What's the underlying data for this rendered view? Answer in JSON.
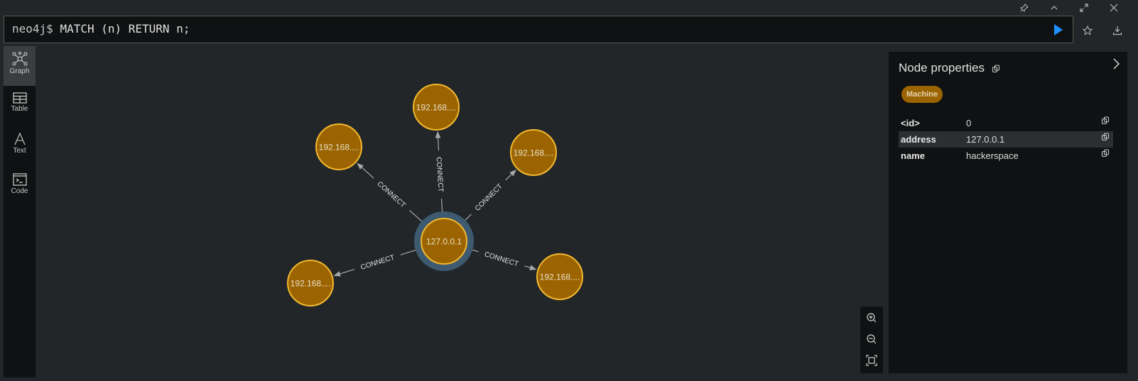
{
  "window": {
    "icons": [
      "pin-icon",
      "chevron-up-icon",
      "maximize-icon",
      "close-icon"
    ]
  },
  "editor": {
    "prompt": "neo4j$",
    "query": "MATCH (n) RETURN n;"
  },
  "actions": {
    "run": "run-icon",
    "favorite": "star-icon",
    "download": "download-icon"
  },
  "nav": {
    "items": [
      {
        "label": "Graph",
        "icon": "graph-icon",
        "active": true
      },
      {
        "label": "Table",
        "icon": "table-icon",
        "active": false
      },
      {
        "label": "Text",
        "icon": "text-icon",
        "active": false
      },
      {
        "label": "Code",
        "icon": "code-icon",
        "active": false
      }
    ]
  },
  "graph": {
    "node_color": "#9b6400",
    "node_border": "#f2b82e",
    "selected_halo": "#3d5a70",
    "relationship_type": "CONNECT",
    "nodes": [
      {
        "id": "center",
        "label": "127.0.0.1",
        "selected": true
      },
      {
        "id": "n-top",
        "label": "192.168...."
      },
      {
        "id": "n-topleft",
        "label": "192.168...."
      },
      {
        "id": "n-topright",
        "label": "192.168...."
      },
      {
        "id": "n-bottomleft",
        "label": "192.168...."
      },
      {
        "id": "n-bottomright",
        "label": "192.168...."
      }
    ],
    "edges": [
      {
        "from": "center",
        "to": "n-top",
        "label": "CONNECT"
      },
      {
        "from": "center",
        "to": "n-topleft",
        "label": "CONNECT"
      },
      {
        "from": "center",
        "to": "n-topright",
        "label": "CONNECT"
      },
      {
        "from": "center",
        "to": "n-bottomleft",
        "label": "CONNECT"
      },
      {
        "from": "center",
        "to": "n-bottomright",
        "label": "CONNECT"
      }
    ]
  },
  "zoom_controls": [
    "zoom-in-icon",
    "zoom-out-icon",
    "fit-icon"
  ],
  "panel": {
    "title": "Node properties",
    "label_badge": "Machine",
    "properties": [
      {
        "key": "<id>",
        "value": "0"
      },
      {
        "key": "address",
        "value": "127.0.0.1"
      },
      {
        "key": "name",
        "value": "hackerspace"
      }
    ]
  }
}
